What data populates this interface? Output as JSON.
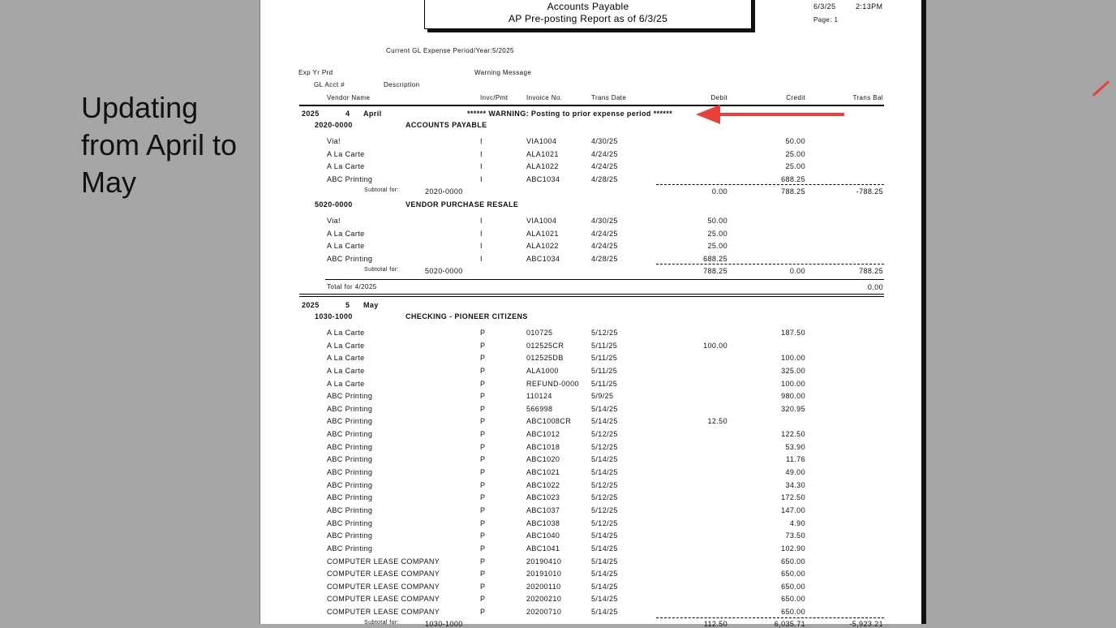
{
  "side_note": "Updating from April to May",
  "report": {
    "title": "Accounts Payable",
    "subtitle": "AP Pre-posting Report as of 6/3/25",
    "date": "6/3/25",
    "time": "2:13PM",
    "page": "Page: 1",
    "current_period": "Current GL Expense Period/Year:5/2025",
    "headers": {
      "exp_yr_prd": "Exp Yr Prd",
      "warning_message": "Warning Message",
      "gl_acct": "GL Acct #",
      "description": "Description",
      "vendor_name": "Vendor Name",
      "invc_pmt": "Invc/Pmt",
      "invoice_no": "Invoice No.",
      "trans_date": "Trans Date",
      "debit": "Debit",
      "credit": "Credit",
      "trans_bal": "Trans Bal"
    },
    "april": {
      "year": "2025",
      "prd": "4",
      "month": "April",
      "warning": "****** WARNING: Posting to prior expense period ******",
      "groups": [
        {
          "acct": "2020-0000",
          "desc": "ACCOUNTS PAYABLE",
          "rows": [
            {
              "vendor": "Via!",
              "type": "I",
              "inv": "VIA1004",
              "date": "4/30/25",
              "debit": "",
              "credit": "50.00"
            },
            {
              "vendor": "A La Carte",
              "type": "I",
              "inv": "ALA1021",
              "date": "4/24/25",
              "debit": "",
              "credit": "25.00"
            },
            {
              "vendor": "A La Carte",
              "type": "I",
              "inv": "ALA1022",
              "date": "4/24/25",
              "debit": "",
              "credit": "25.00"
            },
            {
              "vendor": "ABC Printing",
              "type": "I",
              "inv": "ABC1034",
              "date": "4/28/25",
              "debit": "",
              "credit": "688.25"
            }
          ],
          "subtotal_label": "Subtotal for:",
          "subtotal_debit": "0.00",
          "subtotal_credit": "788.25",
          "subtotal_bal": "-788.25"
        },
        {
          "acct": "5020-0000",
          "desc": "VENDOR PURCHASE RESALE",
          "rows": [
            {
              "vendor": "Via!",
              "type": "I",
              "inv": "VIA1004",
              "date": "4/30/25",
              "debit": "50.00",
              "credit": ""
            },
            {
              "vendor": "A La Carte",
              "type": "I",
              "inv": "ALA1021",
              "date": "4/24/25",
              "debit": "25.00",
              "credit": ""
            },
            {
              "vendor": "A La Carte",
              "type": "I",
              "inv": "ALA1022",
              "date": "4/24/25",
              "debit": "25.00",
              "credit": ""
            },
            {
              "vendor": "ABC Printing",
              "type": "I",
              "inv": "ABC1034",
              "date": "4/28/25",
              "debit": "688.25",
              "credit": ""
            }
          ],
          "subtotal_label": "Subtotal for:",
          "subtotal_debit": "788.25",
          "subtotal_credit": "0.00",
          "subtotal_bal": "788.25"
        }
      ],
      "total_label": "Total for 4/2025",
      "total_value": "0.00"
    },
    "may": {
      "year": "2025",
      "prd": "5",
      "month": "May",
      "acct": "1030-1000",
      "desc": "CHECKING - PIONEER CITIZENS",
      "rows": [
        {
          "vendor": "A La Carte",
          "type": "P",
          "inv": "010725",
          "date": "5/12/25",
          "debit": "",
          "credit": "187.50"
        },
        {
          "vendor": "A La Carte",
          "type": "P",
          "inv": "012525CR",
          "date": "5/11/25",
          "debit": "100.00",
          "credit": ""
        },
        {
          "vendor": "A La Carte",
          "type": "P",
          "inv": "012525DB",
          "date": "5/11/25",
          "debit": "",
          "credit": "100.00"
        },
        {
          "vendor": "A La Carte",
          "type": "P",
          "inv": "ALA1000",
          "date": "5/11/25",
          "debit": "",
          "credit": "325.00"
        },
        {
          "vendor": "A La Carte",
          "type": "P",
          "inv": "REFUND-0000",
          "date": "5/11/25",
          "debit": "",
          "credit": "100.00"
        },
        {
          "vendor": "ABC Printing",
          "type": "P",
          "inv": "110124",
          "date": "5/9/25",
          "debit": "",
          "credit": "980.00"
        },
        {
          "vendor": "ABC Printing",
          "type": "P",
          "inv": "566998",
          "date": "5/14/25",
          "debit": "",
          "credit": "320.95"
        },
        {
          "vendor": "ABC Printing",
          "type": "P",
          "inv": "ABC1008CR",
          "date": "5/14/25",
          "debit": "12.50",
          "credit": ""
        },
        {
          "vendor": "ABC Printing",
          "type": "P",
          "inv": "ABC1012",
          "date": "5/12/25",
          "debit": "",
          "credit": "122.50"
        },
        {
          "vendor": "ABC Printing",
          "type": "P",
          "inv": "ABC1018",
          "date": "5/12/25",
          "debit": "",
          "credit": "53.90"
        },
        {
          "vendor": "ABC Printing",
          "type": "P",
          "inv": "ABC1020",
          "date": "5/14/25",
          "debit": "",
          "credit": "11.76"
        },
        {
          "vendor": "ABC Printing",
          "type": "P",
          "inv": "ABC1021",
          "date": "5/14/25",
          "debit": "",
          "credit": "49.00"
        },
        {
          "vendor": "ABC Printing",
          "type": "P",
          "inv": "ABC1022",
          "date": "5/12/25",
          "debit": "",
          "credit": "34.30"
        },
        {
          "vendor": "ABC Printing",
          "type": "P",
          "inv": "ABC1023",
          "date": "5/12/25",
          "debit": "",
          "credit": "172.50"
        },
        {
          "vendor": "ABC Printing",
          "type": "P",
          "inv": "ABC1037",
          "date": "5/12/25",
          "debit": "",
          "credit": "147.00"
        },
        {
          "vendor": "ABC Printing",
          "type": "P",
          "inv": "ABC1038",
          "date": "5/12/25",
          "debit": "",
          "credit": "4.90"
        },
        {
          "vendor": "ABC Printing",
          "type": "P",
          "inv": "ABC1040",
          "date": "5/14/25",
          "debit": "",
          "credit": "73.50"
        },
        {
          "vendor": "ABC Printing",
          "type": "P",
          "inv": "ABC1041",
          "date": "5/14/25",
          "debit": "",
          "credit": "102.90"
        },
        {
          "vendor": "COMPUTER LEASE COMPANY",
          "type": "P",
          "inv": "20190410",
          "date": "5/14/25",
          "debit": "",
          "credit": "650.00"
        },
        {
          "vendor": "COMPUTER LEASE COMPANY",
          "type": "P",
          "inv": "20191010",
          "date": "5/14/25",
          "debit": "",
          "credit": "650.00"
        },
        {
          "vendor": "COMPUTER LEASE COMPANY",
          "type": "P",
          "inv": "20200110",
          "date": "5/14/25",
          "debit": "",
          "credit": "650.00"
        },
        {
          "vendor": "COMPUTER LEASE COMPANY",
          "type": "P",
          "inv": "20200210",
          "date": "5/14/25",
          "debit": "",
          "credit": "650.00"
        },
        {
          "vendor": "COMPUTER LEASE COMPANY",
          "type": "P",
          "inv": "20200710",
          "date": "5/14/25",
          "debit": "",
          "credit": "650.00"
        }
      ],
      "subtotal_label": "Subtotal for:",
      "subtotal_debit": "112.50",
      "subtotal_credit": "6,035.71",
      "subtotal_bal": "-5,923.21"
    }
  },
  "colors": {
    "arrow": "#e8403a",
    "background": "#a6a6a6"
  },
  "icons": {
    "warning_pointer": "red-arrow-icon",
    "corner_mark": "red-line-icon"
  }
}
